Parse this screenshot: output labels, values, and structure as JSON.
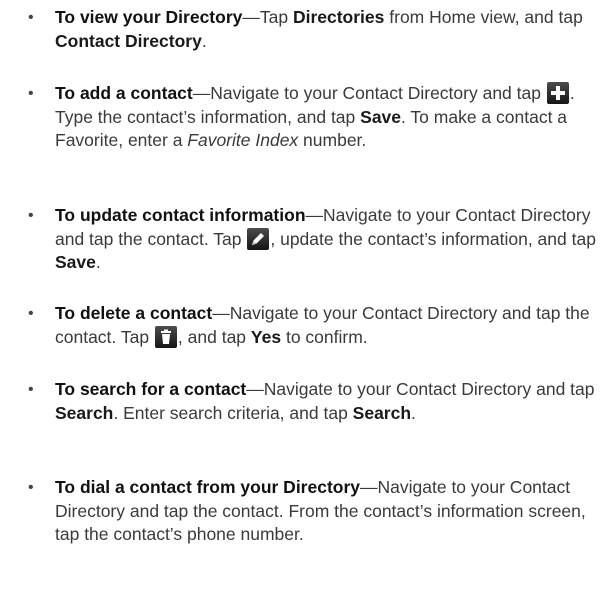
{
  "bullet_glyph": "•",
  "items": [
    {
      "lead": "To view your Directory",
      "s1": "—Tap ",
      "k1": "Directories",
      "s2": " from Home view, and tap ",
      "k2": "Contact Directory",
      "s3": "."
    },
    {
      "lead": "To add a contact",
      "s1": "—Navigate to your Contact Directory and tap ",
      "icon": "add-icon",
      "s2": ". Type the contact’s information, and tap ",
      "k1": "Save",
      "s3": ". To make a contact a Favorite, enter a ",
      "em": "Favorite Index",
      "s4": " number."
    },
    {
      "lead": "To update contact information",
      "s1": "—Navigate to your Contact Directory and tap the contact. Tap ",
      "icon": "pencil-icon",
      "s2": ", update the contact’s information, and tap ",
      "k1": "Save",
      "s3": "."
    },
    {
      "lead": "To delete a contact",
      "s1": "—Navigate to your Contact Directory and tap the contact. Tap ",
      "icon": "trash-icon",
      "s2": ", and tap ",
      "k1": "Yes",
      "s3": " to confirm."
    },
    {
      "lead": "To search for a contact",
      "s1": "—Navigate to your Contact Directory and tap ",
      "k1": "Search",
      "s2": ". Enter search criteria, and tap ",
      "k2": "Search",
      "s3": "."
    },
    {
      "lead": "To dial a contact from your Directory",
      "s1": "—Navigate to your Contact Directory and tap the contact. From the contact’s information screen, tap the contact’s phone number."
    }
  ]
}
